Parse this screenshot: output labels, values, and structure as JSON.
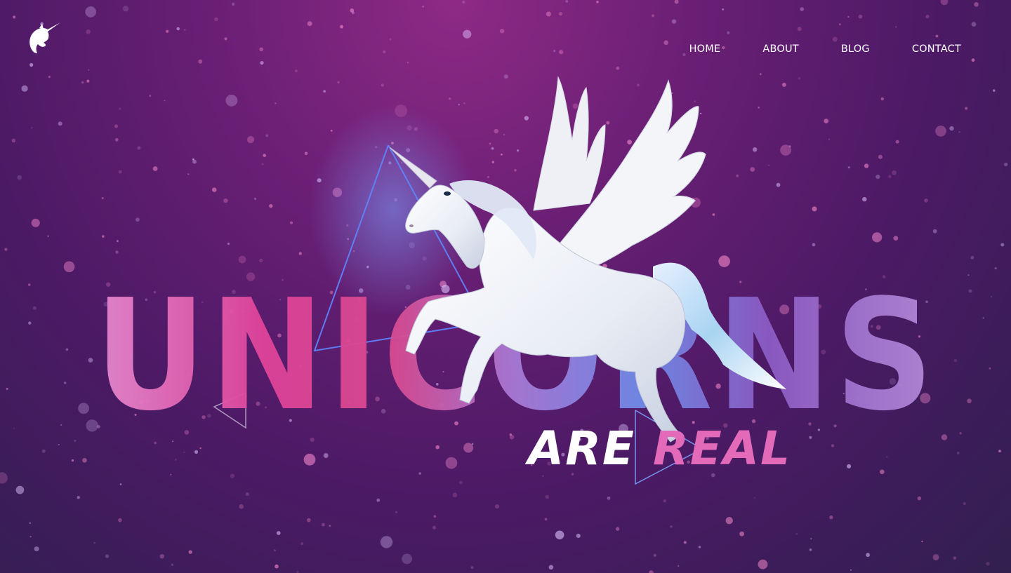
{
  "brand": {
    "logo_icon": "unicorn-head-icon",
    "background_color": "#4d1a66",
    "accent_pink": "#e0449a",
    "accent_lilac": "#b48ad8",
    "accent_blue": "#5a7cf0"
  },
  "nav": {
    "items": [
      {
        "label": "HOME"
      },
      {
        "label": "ABOUT"
      },
      {
        "label": "BLOG"
      },
      {
        "label": "CONTACT"
      }
    ]
  },
  "hero": {
    "title": "UNICORNS",
    "subtitle_part1": "ARE ",
    "subtitle_part2": "REAL",
    "illustration_icon": "winged-unicorn-icon"
  }
}
